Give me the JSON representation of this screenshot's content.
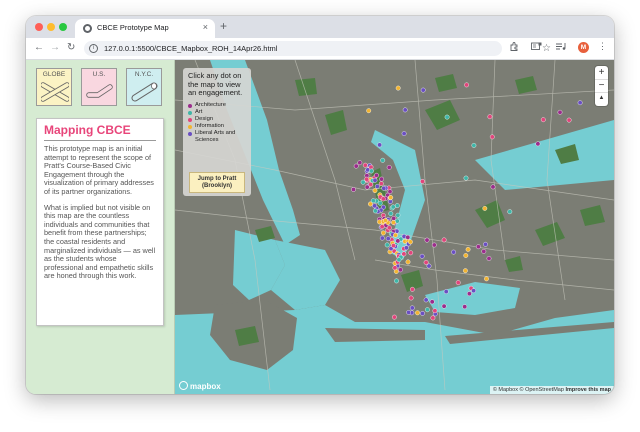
{
  "browser": {
    "tab_title": "CBCE Prototype Map",
    "tab_close": "×",
    "new_tab": "+",
    "url": "127.0.0.1:5500/CBCE_Mapbox_ROH_14Apr26.html",
    "nav": {
      "back": "←",
      "forward": "→",
      "reload": "↻"
    },
    "profile_initial": "M",
    "menu": "⋮",
    "star": "☆"
  },
  "sidebar": {
    "scope_buttons": [
      {
        "label": "GLOBE"
      },
      {
        "label": "U.S."
      },
      {
        "label": "N.Y.C."
      }
    ],
    "card": {
      "title": "Mapping CBCE",
      "paragraph_1": "This prototype map is an initial attempt to represent the scope of Pratt's Course-Based Civic Engagement through the visualization of primary addresses of its partner organizations.",
      "paragraph_2": "What is implied but not visible on this map are the countless individuals and communities that benefit from these partnerships; the coastal residents and marginalized individuals — as well as the students whose professional and empathetic skills are honed through this work."
    }
  },
  "map": {
    "legend": {
      "intro": "Click any dot on the map to view an engagement.",
      "items": [
        {
          "label": "Architecture",
          "color": "#9b2d8c"
        },
        {
          "label": "Art",
          "color": "#3fb6a8"
        },
        {
          "label": "Design",
          "color": "#e0457b"
        },
        {
          "label": "Information",
          "color": "#f2b431"
        },
        {
          "label": "Liberal Arts and Sciences",
          "color": "#6a4fc2"
        }
      ],
      "jump_button": "Jump to Pratt (Brooklyn)"
    },
    "zoom": {
      "in": "+",
      "out": "−",
      "compass": "▲"
    },
    "logo": "mapbox",
    "attribution": "© Mapbox © OpenStreetMap",
    "improve": "Improve this map",
    "colors": {
      "water": "#75cdd2",
      "land": "#7b7d74",
      "park": "#4f7d45"
    }
  }
}
